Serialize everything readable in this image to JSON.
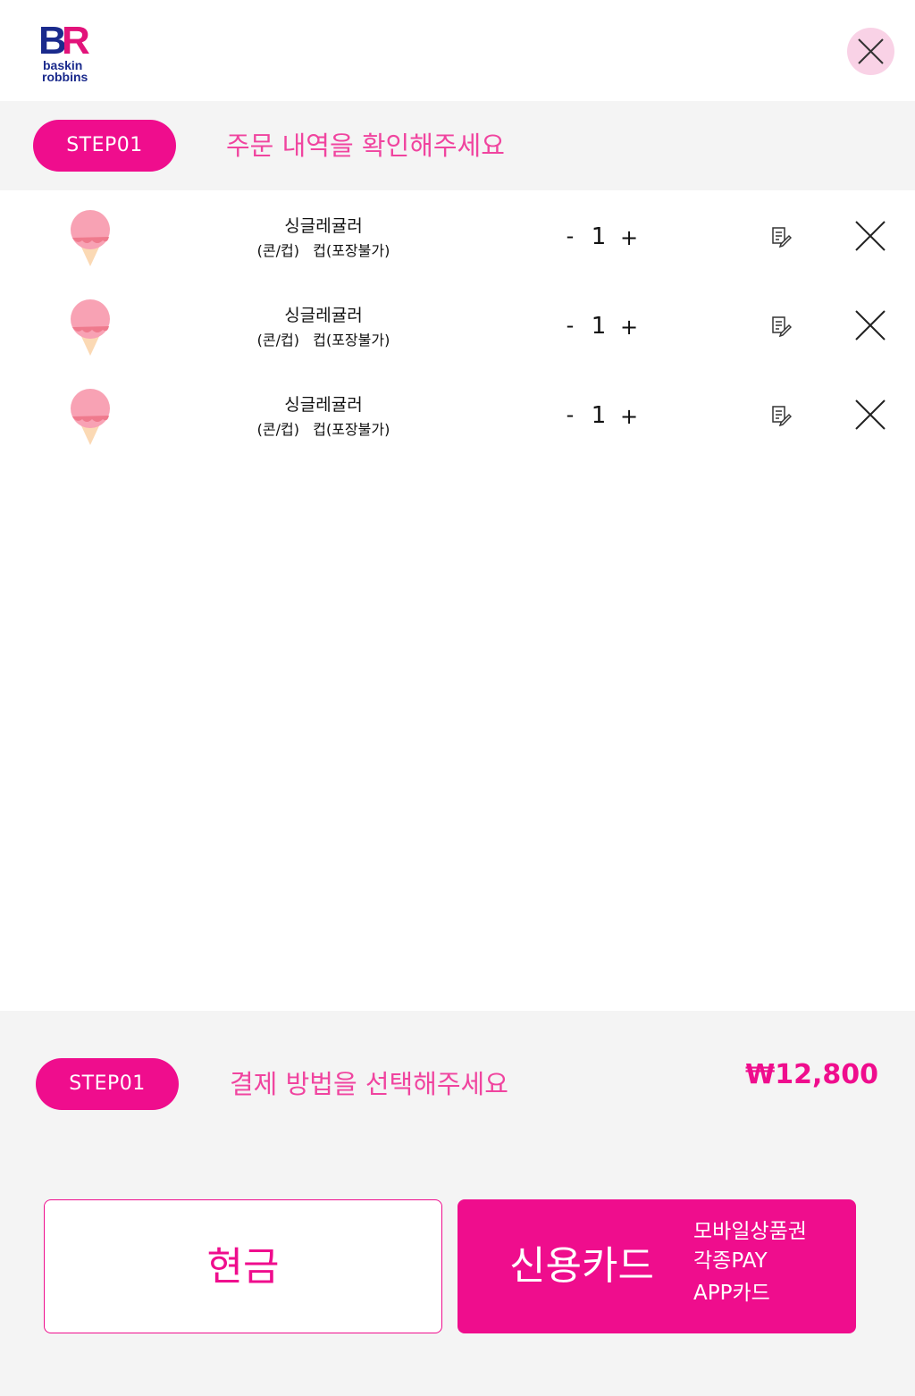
{
  "header": {
    "logo_text": "baskin robbins",
    "close_label": "close"
  },
  "order_step": {
    "step_label": "STEP01",
    "title": "주문 내역을 확인해주세요"
  },
  "items": [
    {
      "name": "싱글레귤러",
      "options": "(콘/컵)   컵(포장불가)",
      "minus": "-",
      "quantity": "1",
      "plus": "+"
    },
    {
      "name": "싱글레귤러",
      "options": "(콘/컵)   컵(포장불가)",
      "minus": "-",
      "quantity": "1",
      "plus": "+"
    },
    {
      "name": "싱글레귤러",
      "options": "(콘/컵)   컵(포장불가)",
      "minus": "-",
      "quantity": "1",
      "plus": "+"
    }
  ],
  "payment_step": {
    "step_label": "STEP01",
    "title": "결제 방법을 선택해주세요",
    "total": "₩12,800"
  },
  "payment_options": {
    "cash_label": "현금",
    "card_label": "신용카드",
    "card_sub": [
      "모바일상품권",
      "각종PAY",
      "APP카드"
    ]
  },
  "colors": {
    "accent": "#ef0d8d",
    "accent_light": "#f0449f",
    "close_bg": "#f9d2e6",
    "band_bg": "#f4f4f4",
    "logo_blue": "#1a2a8c",
    "logo_pink": "#e2137a",
    "scoop": "#f8a2b4",
    "cone": "#fbd9b4"
  },
  "icons": {
    "close": "close-icon",
    "memo": "memo-edit-icon",
    "remove": "remove-x-icon",
    "product": "ice-cream-cone-icon"
  }
}
